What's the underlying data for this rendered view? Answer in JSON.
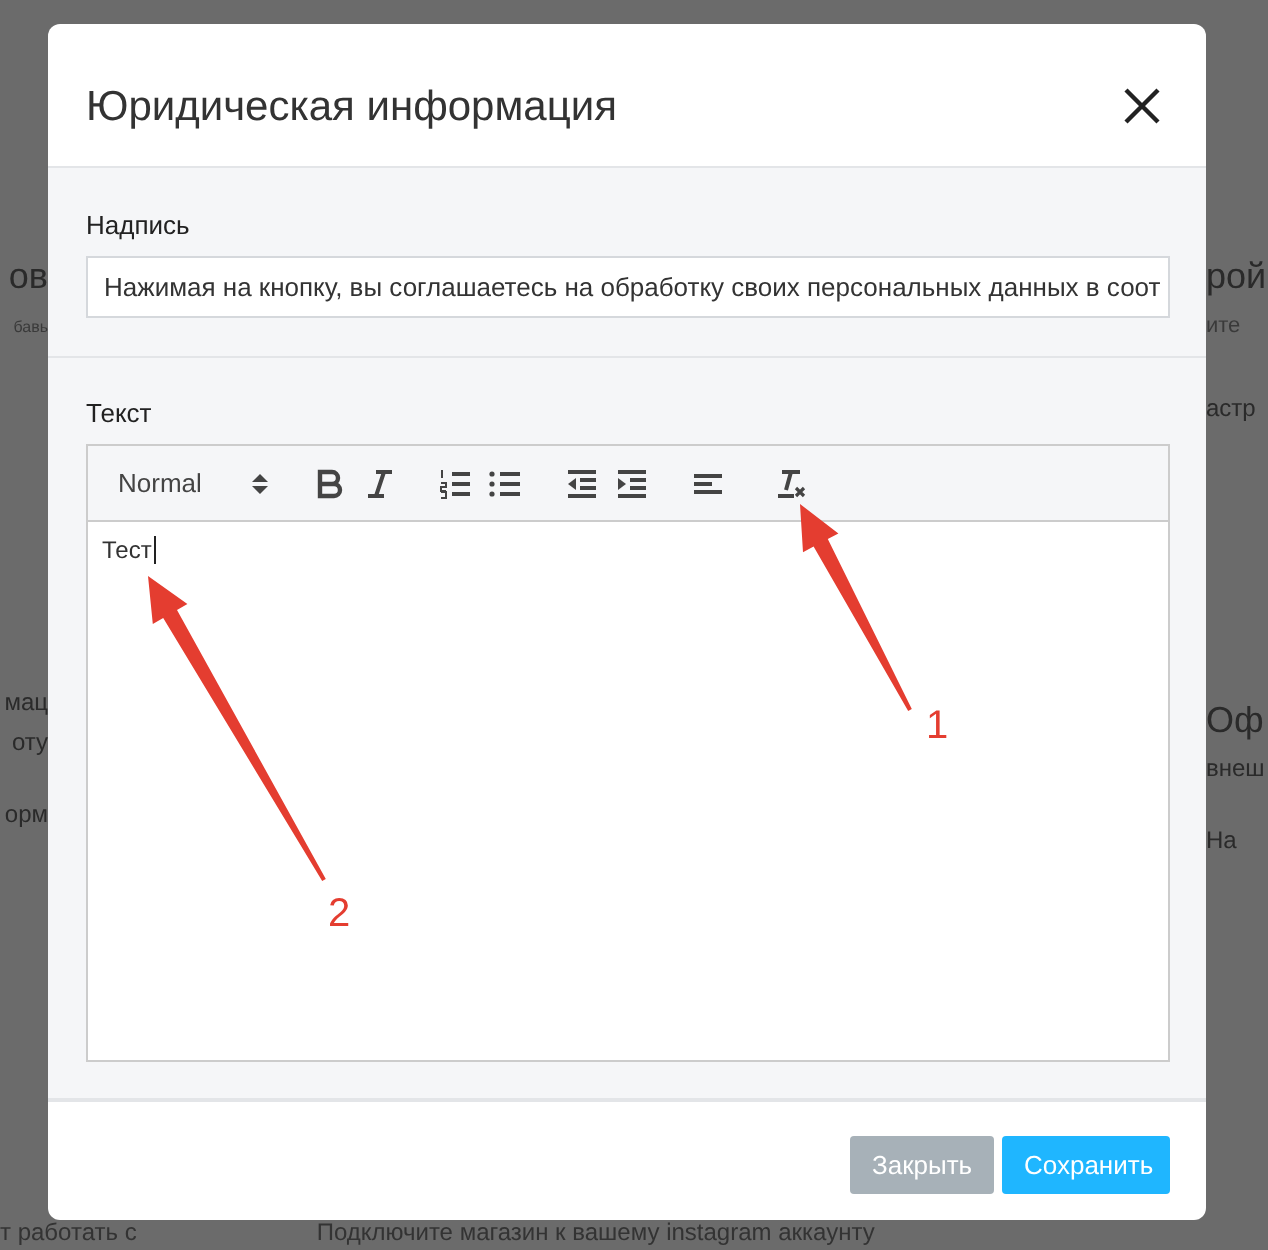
{
  "background": {
    "left_fragments": [
      "ов",
      "бавь",
      "мац",
      "оту",
      "орм"
    ],
    "right_fragments": [
      "рой",
      "ите",
      "астр",
      "Оф",
      "внеш",
      "На"
    ],
    "bottom_fragments": [
      "т работать с",
      "Подключите магазин к вашему instagram аккаунту"
    ]
  },
  "dialog": {
    "title": "Юридическая информация",
    "fields": [
      {
        "label": "Надпись",
        "kind": "text",
        "value": "Нажимая на кнопку, вы соглашаетесь на обработку своих персональных данных в соот"
      },
      {
        "label": "Текст",
        "kind": "editor",
        "format": "Normal",
        "value": "Тест"
      }
    ],
    "buttons": [
      {
        "label": "Закрыть",
        "kind": "secondary"
      },
      {
        "label": "Сохранить",
        "kind": "primary"
      }
    ]
  },
  "annotations": [
    {
      "label": "1"
    },
    {
      "label": "2"
    }
  ]
}
